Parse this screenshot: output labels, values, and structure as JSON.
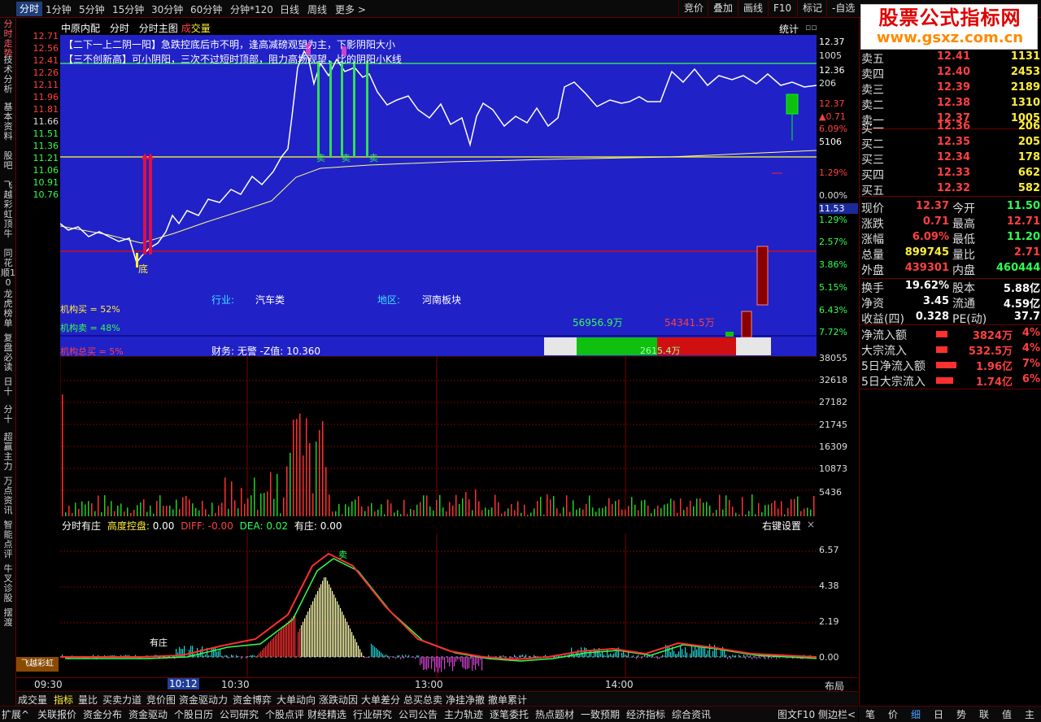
{
  "topbar": {
    "tabs": [
      "分时",
      "1分钟",
      "5分钟",
      "15分钟",
      "30分钟",
      "60分钟",
      "分钟*120",
      "日线",
      "周线",
      "更多 >"
    ],
    "right_buttons": [
      "竞价",
      "叠加",
      "画线",
      "F10",
      "标记",
      "-自选"
    ]
  },
  "left_tabs": [
    "分时走势",
    "技术分析",
    "基本资料",
    "股吧",
    "飞越彩虹",
    "顶牛",
    "同花顺10",
    "龙虎榜单",
    "复盘必读",
    "日十",
    "分十",
    "超赢主力",
    "万点资讯",
    "智能点评",
    "牛叉诊股",
    "摆渡"
  ],
  "chart": {
    "stock_name": "中原内配",
    "mode": "分时",
    "main_label": "分时主图",
    "indicator_prefix": "成",
    "indicator_suffix": "交量",
    "stats_label": "统计",
    "notes": [
      "【二下一上二阴一阳】急跌控底后市不明，逢高减磅观望为主，下影阴阳大小",
      "【三不创新高】可小阴阳，三次不过短时顶部，阻力高场观望，比的阴阳小K线"
    ],
    "industry_label": "行业:",
    "industry": "汽车类",
    "region_label": "地区:",
    "region": "河南板块",
    "inst_buy": "机构买 = 52%",
    "inst_sell": "机构卖 = 48%",
    "inst_total": "机构总买 = 5%",
    "finance": "财务: 无警  -Z值: 10.360",
    "flow_in": "56956.9万",
    "flow_out": "54341.5万",
    "flow_net": "2615.4万",
    "marker_bottom": "底",
    "marker_sell": "卖",
    "marker_buy_zhuang": "有庄"
  },
  "price_axis_left": [
    "12.71",
    "12.56",
    "12.41",
    "12.26",
    "12.11",
    "11.96",
    "11.81",
    "11.66",
    "11.51",
    "11.36",
    "11.21",
    "11.06",
    "10.91",
    "10.76"
  ],
  "price_axis_right": [
    "12.37",
    "1005",
    "12.36",
    "206",
    "12.37",
    "▲0.71",
    "6.09%",
    "5106",
    "1.29%",
    "0.00%",
    "11.53",
    "1.29%",
    "2.57%",
    "3.86%",
    "5.15%",
    "6.43%",
    "7.72%"
  ],
  "volume_axis": [
    "38055",
    "32618",
    "27182",
    "21745",
    "16309",
    "10873",
    "5436"
  ],
  "macd": {
    "title": "分时有庄",
    "kp_label": "高度控盘:",
    "kp_value": "0.00",
    "diff": "DIFF: -0.00",
    "dea": "DEA: 0.02",
    "yz": "有庄: 0.00",
    "settings": "右键设置",
    "close": "×",
    "axis": [
      "6.57",
      "4.38",
      "2.19",
      "0.00"
    ],
    "sell_mark": "卖",
    "zhuang_mark": "有庄"
  },
  "time_axis": [
    "09:30",
    "10:12",
    "10:30",
    "13:00",
    "14:00"
  ],
  "layout_label": "布局",
  "bottom_tabs1": [
    "成交量",
    "指标",
    "量比",
    "买卖力道",
    "竞价图",
    "资金驱动力",
    "资金博弈",
    "大单动向",
    "涨跌动因",
    "大单差分",
    "总买总卖",
    "净挂净撤",
    "撤单累计"
  ],
  "bottom_tabs2": [
    "扩展^",
    "关联报价",
    "资金分布",
    "资金驱动",
    "个股日历",
    "公司研究",
    "个股点评",
    "财经精选",
    "行业研究",
    "公司公告",
    "主力轨迹",
    "逐笔委托",
    "热点题材",
    "一致预期",
    "经济指标",
    "综合资讯",
    "图文F10",
    "侧边栏<"
  ],
  "right_bottom_tabs": [
    "笔",
    "价",
    "细",
    "日",
    "势",
    "联",
    "值",
    "主"
  ],
  "banner": {
    "title": "股票公式指标网",
    "url": "www.gsxz.com.cn"
  },
  "orderbook": {
    "sell": [
      {
        "label": "卖五",
        "price": "12.41",
        "vol": "1131"
      },
      {
        "label": "卖四",
        "price": "12.40",
        "vol": "2453"
      },
      {
        "label": "卖三",
        "price": "12.39",
        "vol": "2189"
      },
      {
        "label": "卖二",
        "price": "12.38",
        "vol": "1310"
      },
      {
        "label": "卖一",
        "price": "12.37",
        "vol": "1005"
      }
    ],
    "buy": [
      {
        "label": "买一",
        "price": "12.36",
        "vol": "206"
      },
      {
        "label": "买二",
        "price": "12.35",
        "vol": "205"
      },
      {
        "label": "买三",
        "price": "12.34",
        "vol": "178"
      },
      {
        "label": "买四",
        "price": "12.33",
        "vol": "662"
      },
      {
        "label": "买五",
        "price": "12.32",
        "vol": "582"
      }
    ]
  },
  "quote": [
    {
      "l1": "现价",
      "v1": "12.37",
      "l2": "今开",
      "v2": "11.50"
    },
    {
      "l1": "涨跌",
      "v1": "0.71",
      "l2": "最高",
      "v2": "12.71"
    },
    {
      "l1": "涨幅",
      "v1": "6.09%",
      "l2": "最低",
      "v2": "11.20"
    },
    {
      "l1": "总量",
      "v1": "899745",
      "l2": "量比",
      "v2": "2.71"
    },
    {
      "l1": "外盘",
      "v1": "439301",
      "l2": "内盘",
      "v2": "460444"
    },
    {
      "l1": "换手",
      "v1": "19.62%",
      "l2": "股本",
      "v2": "5.88亿"
    },
    {
      "l1": "净资",
      "v1": "3.45",
      "l2": "流通",
      "v2": "4.59亿"
    },
    {
      "l1": "收益(四)",
      "v1": "0.328",
      "l2": "PE(动)",
      "v2": "37.7"
    }
  ],
  "flows": [
    {
      "label": "净流入额",
      "value": "3824万",
      "pct": "4%",
      "bar": 0.04
    },
    {
      "label": "大宗流入",
      "value": "532.5万",
      "pct": "4%",
      "bar": 0.04
    },
    {
      "label": "5日净流入额",
      "value": "1.96亿",
      "pct": "7%",
      "bar": 0.07
    },
    {
      "label": "5日大宗流入",
      "value": "1.74亿",
      "pct": "6%",
      "bar": 0.06
    }
  ],
  "logo_text": "飞越彩虹",
  "colors": {
    "up": "#ff4040",
    "down": "#00c000",
    "panel_blue": "#2121c8",
    "grid_red": "#7a0000",
    "yellow": "#ffef3a"
  }
}
